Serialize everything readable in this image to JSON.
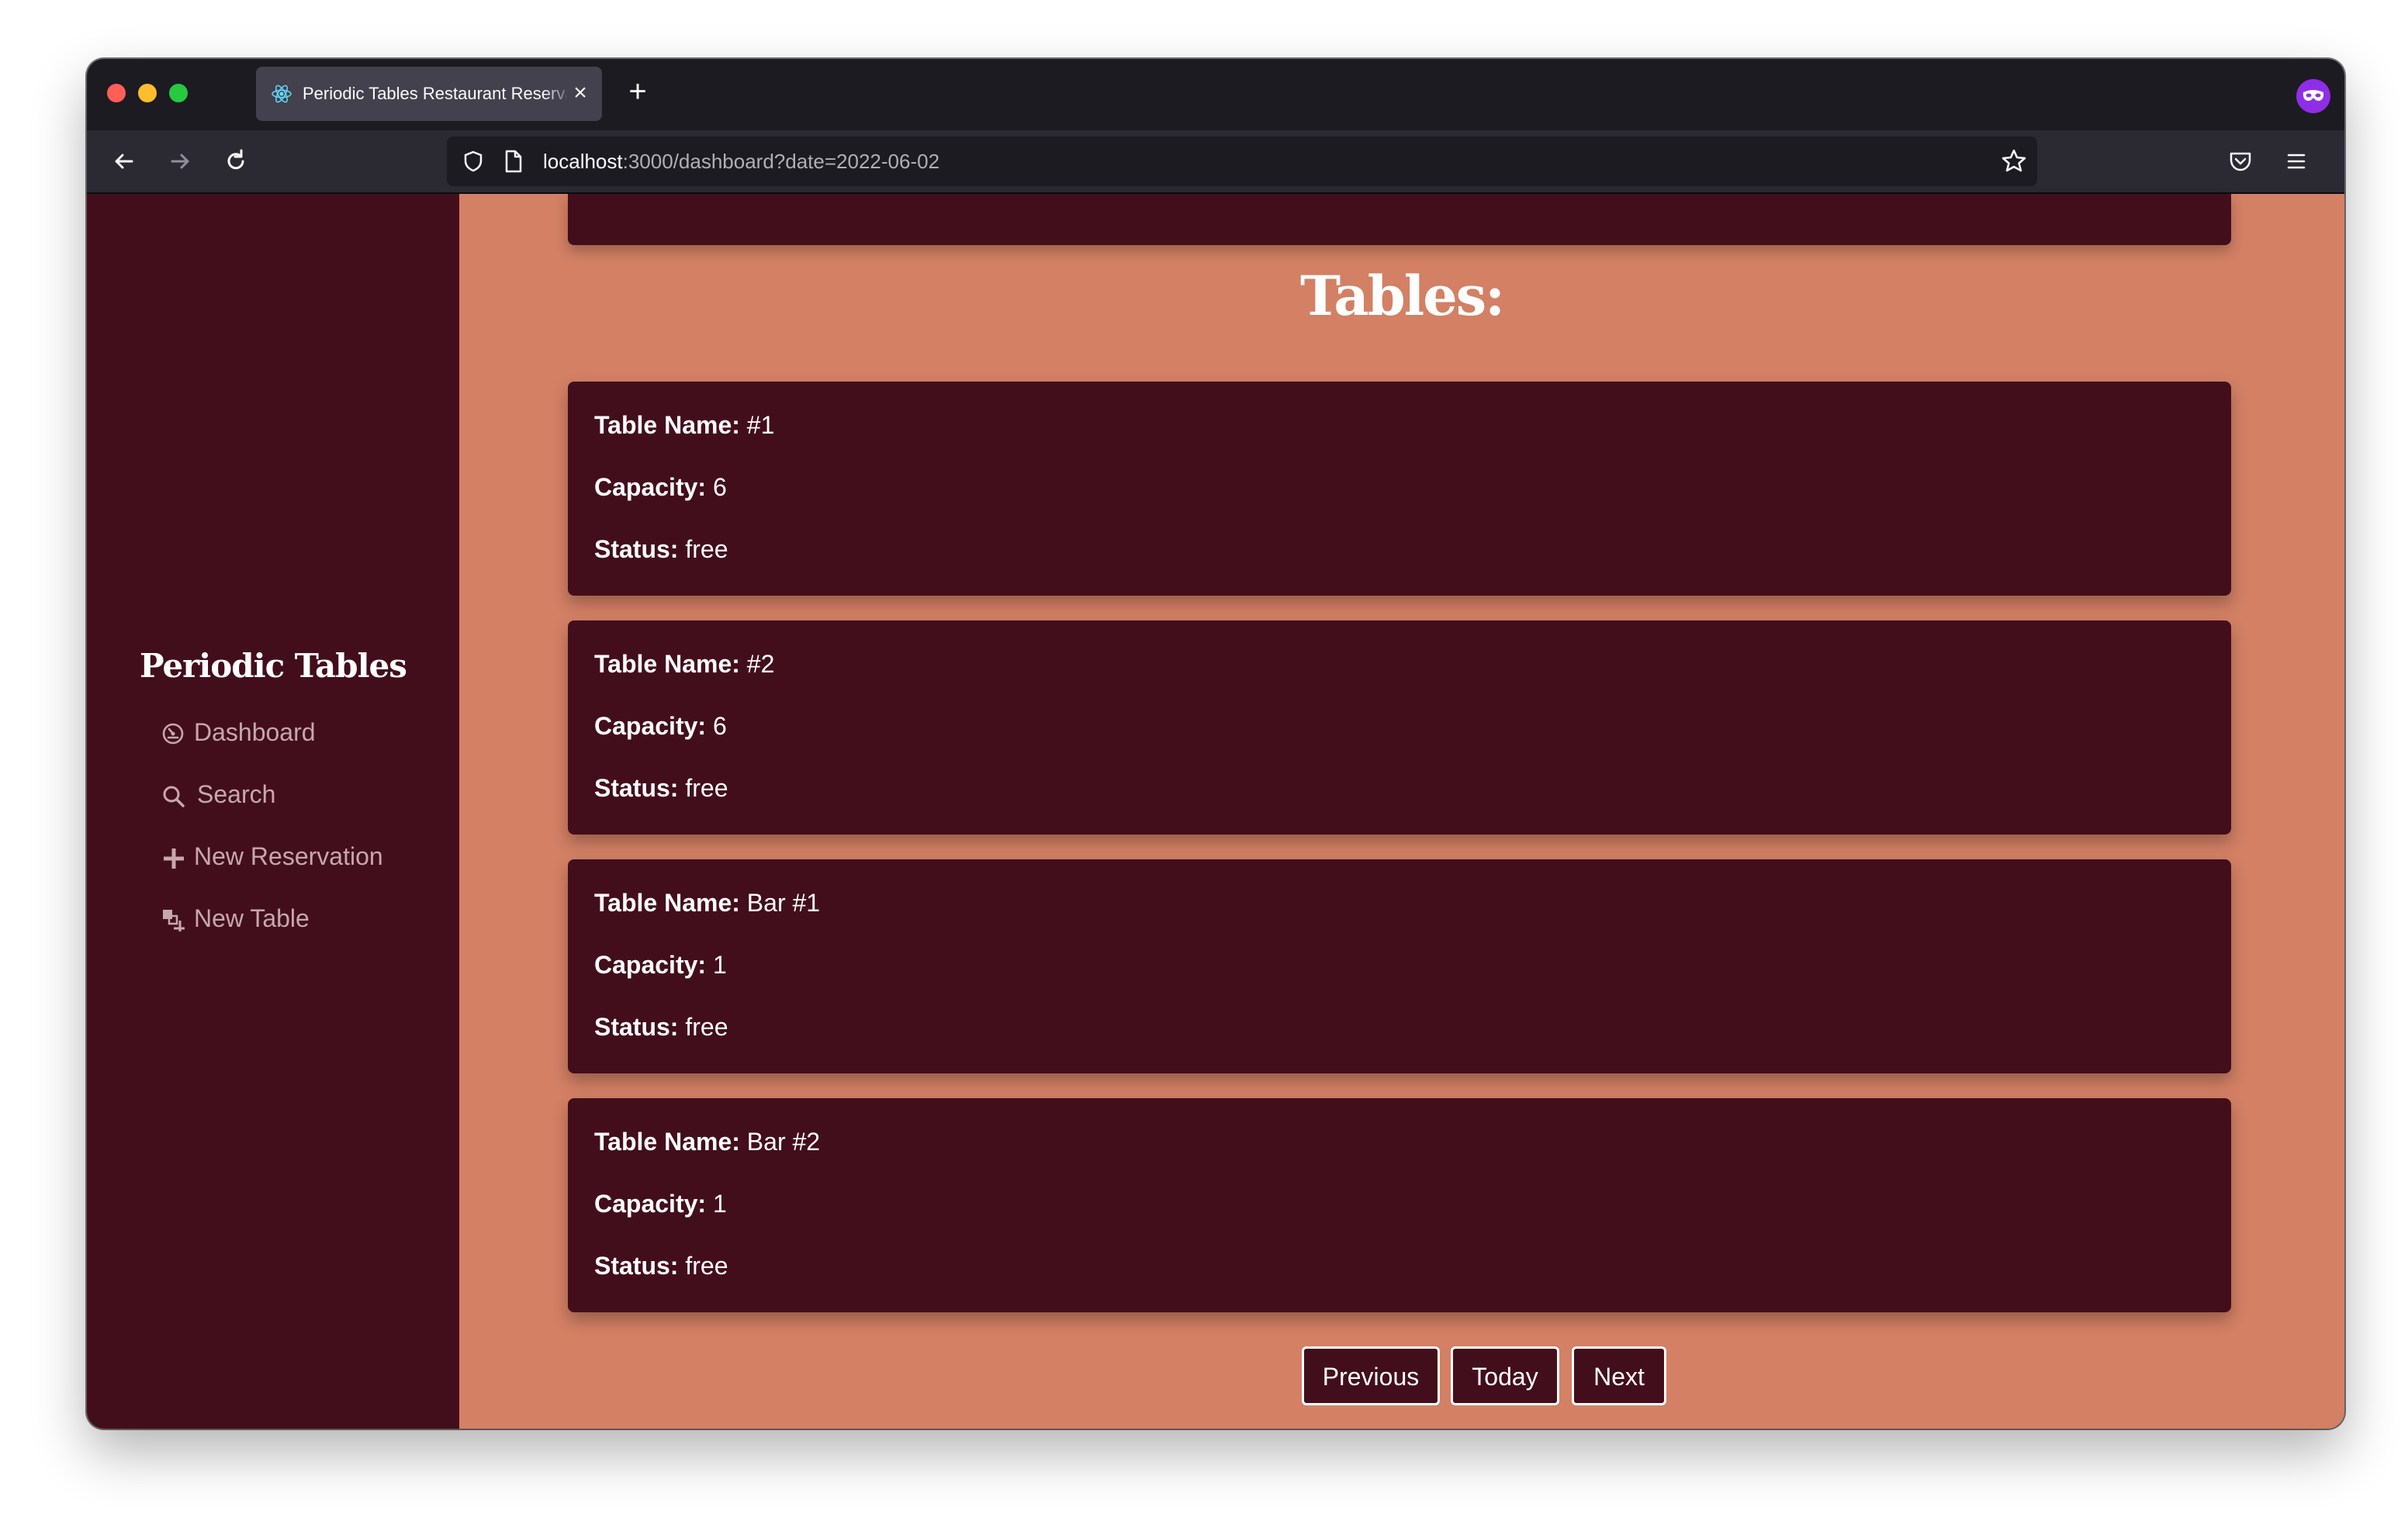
{
  "browser": {
    "tab_title": "Periodic Tables Restaurant Reservations",
    "url_host": "localhost",
    "url_rest": ":3000/dashboard?date=2022-06-02"
  },
  "sidebar": {
    "brand": "Periodic Tables",
    "items": [
      {
        "label": "Dashboard",
        "icon": "dashboard-icon"
      },
      {
        "label": "Search",
        "icon": "search-icon"
      },
      {
        "label": "New Reservation",
        "icon": "plus-icon"
      },
      {
        "label": "New Table",
        "icon": "table-icon"
      }
    ]
  },
  "main": {
    "heading": "Tables:",
    "field_labels": {
      "name": "Table Name:",
      "capacity": "Capacity:",
      "status": "Status:"
    },
    "tables": [
      {
        "name": "#1",
        "capacity": "6",
        "status": "free"
      },
      {
        "name": "#2",
        "capacity": "6",
        "status": "free"
      },
      {
        "name": "Bar #1",
        "capacity": "1",
        "status": "free"
      },
      {
        "name": "Bar #2",
        "capacity": "1",
        "status": "free"
      }
    ],
    "pager": {
      "previous": "Previous",
      "today": "Today",
      "next": "Next"
    }
  },
  "colors": {
    "sidebar_bg": "#430e1c",
    "page_bg": "#d38065",
    "card_bg": "#430e1c"
  }
}
